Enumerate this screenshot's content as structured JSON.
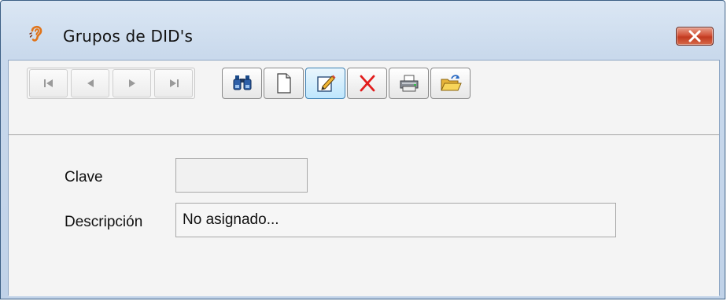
{
  "window": {
    "title": "Grupos de DID's",
    "app_icon": "ear-icon",
    "close_icon": "close-icon"
  },
  "toolbar": {
    "navigation": [
      {
        "name": "first-record-button",
        "icon": "skip-first-icon"
      },
      {
        "name": "previous-record-button",
        "icon": "triangle-left-icon"
      },
      {
        "name": "next-record-button",
        "icon": "triangle-right-icon"
      },
      {
        "name": "last-record-button",
        "icon": "skip-last-icon"
      }
    ],
    "actions": [
      {
        "name": "search-button",
        "icon": "binoculars-icon"
      },
      {
        "name": "new-button",
        "icon": "blank-page-icon"
      },
      {
        "name": "edit-button",
        "icon": "pencil-edit-icon",
        "active": true
      },
      {
        "name": "delete-button",
        "icon": "red-x-icon"
      },
      {
        "name": "print-button",
        "icon": "printer-icon"
      },
      {
        "name": "open-button",
        "icon": "folder-open-icon"
      }
    ]
  },
  "form": {
    "clave_label": "Clave",
    "clave_value": "",
    "descripcion_label": "Descripción",
    "descripcion_value": "No asignado..."
  },
  "colors": {
    "title_bar": "#c9d9ec",
    "close_button": "#c23a20",
    "active_button": "#bee6fd",
    "client_bg": "#f4f4f4"
  }
}
